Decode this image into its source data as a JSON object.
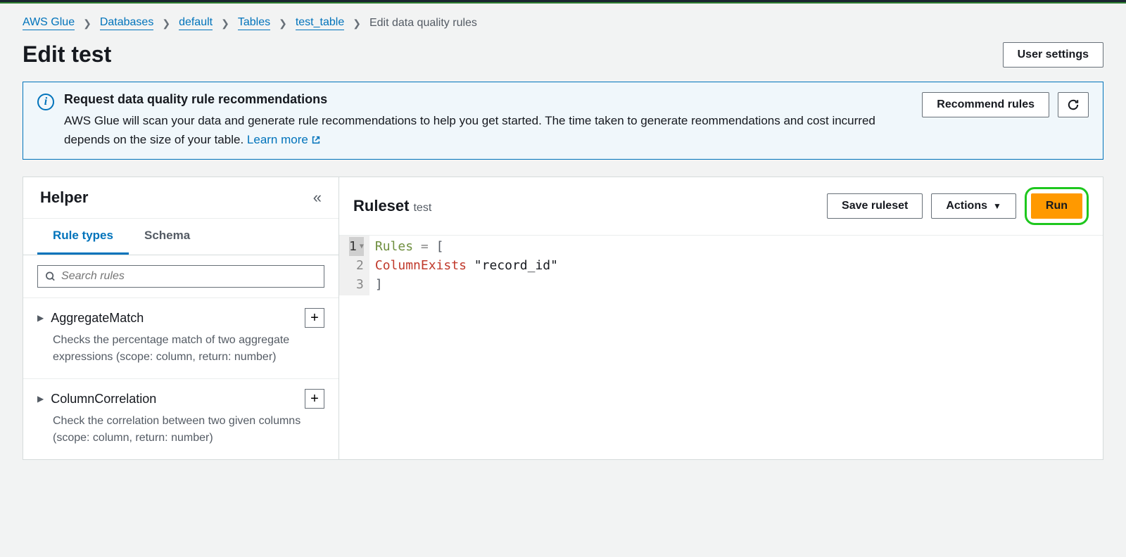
{
  "breadcrumb": [
    {
      "label": "AWS Glue",
      "link": true
    },
    {
      "label": "Databases",
      "link": true
    },
    {
      "label": "default",
      "link": true
    },
    {
      "label": "Tables",
      "link": true
    },
    {
      "label": "test_table",
      "link": true
    },
    {
      "label": "Edit data quality rules",
      "link": false
    }
  ],
  "page": {
    "title": "Edit test",
    "user_settings": "User settings"
  },
  "infobox": {
    "title": "Request data quality rule recommendations",
    "text": "AWS Glue will scan your data and generate rule recommendations to help you get started. The time taken to generate reommendations and cost incurred depends on the size of your table. ",
    "learn_more": "Learn more",
    "recommend": "Recommend rules"
  },
  "helper": {
    "title": "Helper",
    "tabs": {
      "rule_types": "Rule types",
      "schema": "Schema"
    },
    "search_placeholder": "Search rules",
    "rules": [
      {
        "name": "AggregateMatch",
        "desc": "Checks the percentage match of two aggregate expressions (scope: column, return: number)"
      },
      {
        "name": "ColumnCorrelation",
        "desc": "Check the correlation between two given columns (scope: column, return: number)"
      }
    ]
  },
  "ruleset": {
    "title": "Ruleset",
    "name": "test",
    "save": "Save ruleset",
    "actions": "Actions",
    "run": "Run",
    "code": {
      "line1_kw": "Rules",
      "line1_op": "=",
      "line1_br": "[",
      "line2_fn": "ColumnExists",
      "line2_str": "\"record_id\"",
      "line3_br": "]"
    }
  }
}
